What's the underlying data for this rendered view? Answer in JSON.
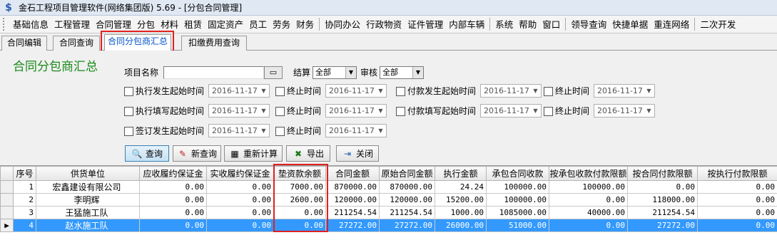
{
  "window": {
    "title": "金石工程项目管理软件(网络集团版) 5.69 - [分包合同管理]",
    "icon": "app-logo-icon"
  },
  "menubar": {
    "items": [
      "基础信息",
      "工程管理",
      "合同管理",
      "分包",
      "材料",
      "租赁",
      "固定资产",
      "员工",
      "劳务",
      "财务",
      "协同办公",
      "行政物资",
      "证件管理",
      "内部车辆",
      "系统",
      "帮助",
      "窗口",
      "领导查询",
      "快捷单据",
      "重连网络",
      "二次开发"
    ]
  },
  "tabs": [
    "合同编辑",
    "合同查询",
    "合同分包商汇总",
    "扣缴费用查询"
  ],
  "panel": {
    "title": "合同分包商汇总",
    "project_label": "项目名称",
    "project_value": "",
    "settle_label": "结算",
    "settle_value": "全部",
    "audit_label": "审核",
    "audit_value": "全部",
    "date_filters": [
      {
        "start_label": "执行发生起始时间",
        "start": "2016-11-17",
        "end_label": "终止时间",
        "end": "2016-11-17"
      },
      {
        "start_label": "付款发生起始时间",
        "start": "2016-11-17",
        "end_label": "终止时间",
        "end": "2016-11-17"
      },
      {
        "start_label": "执行填写起始时间",
        "start": "2016-11-17",
        "end_label": "终止时间",
        "end": "2016-11-17"
      },
      {
        "start_label": "付款填写起始时间",
        "start": "2016-11-17",
        "end_label": "终止时间",
        "end": "2016-11-17"
      },
      {
        "start_label": "签订发生起始时间",
        "start": "2016-11-17",
        "end_label": "终止时间",
        "end": "2016-11-17"
      }
    ],
    "buttons": {
      "query": "查询",
      "new_query": "新查询",
      "recalc": "重新计算",
      "export": "导出",
      "close": "关闭"
    }
  },
  "table": {
    "headers": [
      "序号",
      "供货单位",
      "应收履约保证金",
      "实收履约保证金",
      "垫资款余额",
      "合同金额",
      "原始合同金额",
      "执行金额",
      "承包合同收款",
      "按承包收款付款限额",
      "按合同付款限额",
      "按执行付款限额"
    ],
    "rows": [
      [
        "1",
        "宏鑫建设有限公司",
        "0.00",
        "0.00",
        "7000.00",
        "870000.00",
        "870000.00",
        "24.24",
        "100000.00",
        "100000.00",
        "0.00",
        "0.00"
      ],
      [
        "2",
        "李明辉",
        "0.00",
        "0.00",
        "2600.00",
        "120000.00",
        "120000.00",
        "15200.00",
        "100000.00",
        "0.00",
        "118000.00",
        "0.00"
      ],
      [
        "3",
        "王猛施工队",
        "0.00",
        "0.00",
        "0.00",
        "211254.54",
        "211254.54",
        "1000.00",
        "1085000.00",
        "40000.00",
        "211254.54",
        "0.00"
      ],
      [
        "4",
        "赵水施工队",
        "0.00",
        "0.00",
        "0.00",
        "27272.00",
        "27272.00",
        "26000.00",
        "51000.00",
        "0.00",
        "27272.00",
        "0.00"
      ]
    ],
    "selected_row": 4,
    "highlight_color": "#e02020",
    "selection_color": "#3399ff"
  }
}
